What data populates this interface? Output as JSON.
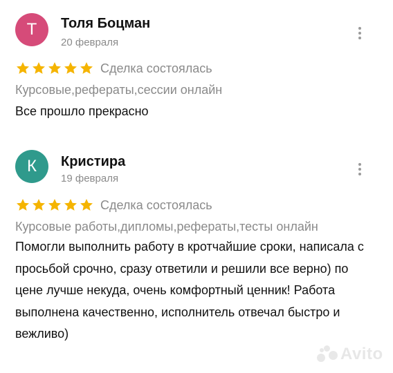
{
  "reviews": [
    {
      "avatar_letter": "Т",
      "avatar_color": "#d64b79",
      "name": "Толя Боцман",
      "date": "20 февраля",
      "rating": 5,
      "deal_status": "Сделка состоялась",
      "category": "Курсовые,рефераты,сессии онлайн",
      "text": "Все прошло прекрасно"
    },
    {
      "avatar_letter": "К",
      "avatar_color": "#2f9a8c",
      "name": "Кристира",
      "date": "19 февраля",
      "rating": 5,
      "deal_status": "Сделка состоялась",
      "category": "Курсовые работы,дипломы,рефераты,тесты онлайн",
      "text": "Помогли выполнить работу в кротчайшие сроки, написала с просьбой срочно, сразу ответили и решили все верно) по цене лучше некуда, очень комфортный ценник! Работа выполнена качественно, исполнитель отвечал быстро и вежливо)"
    }
  ],
  "star_color": "#f5b400",
  "icons": {
    "menu": "more-vertical-icon",
    "star": "star-icon"
  },
  "watermark": {
    "text": "Avito"
  }
}
